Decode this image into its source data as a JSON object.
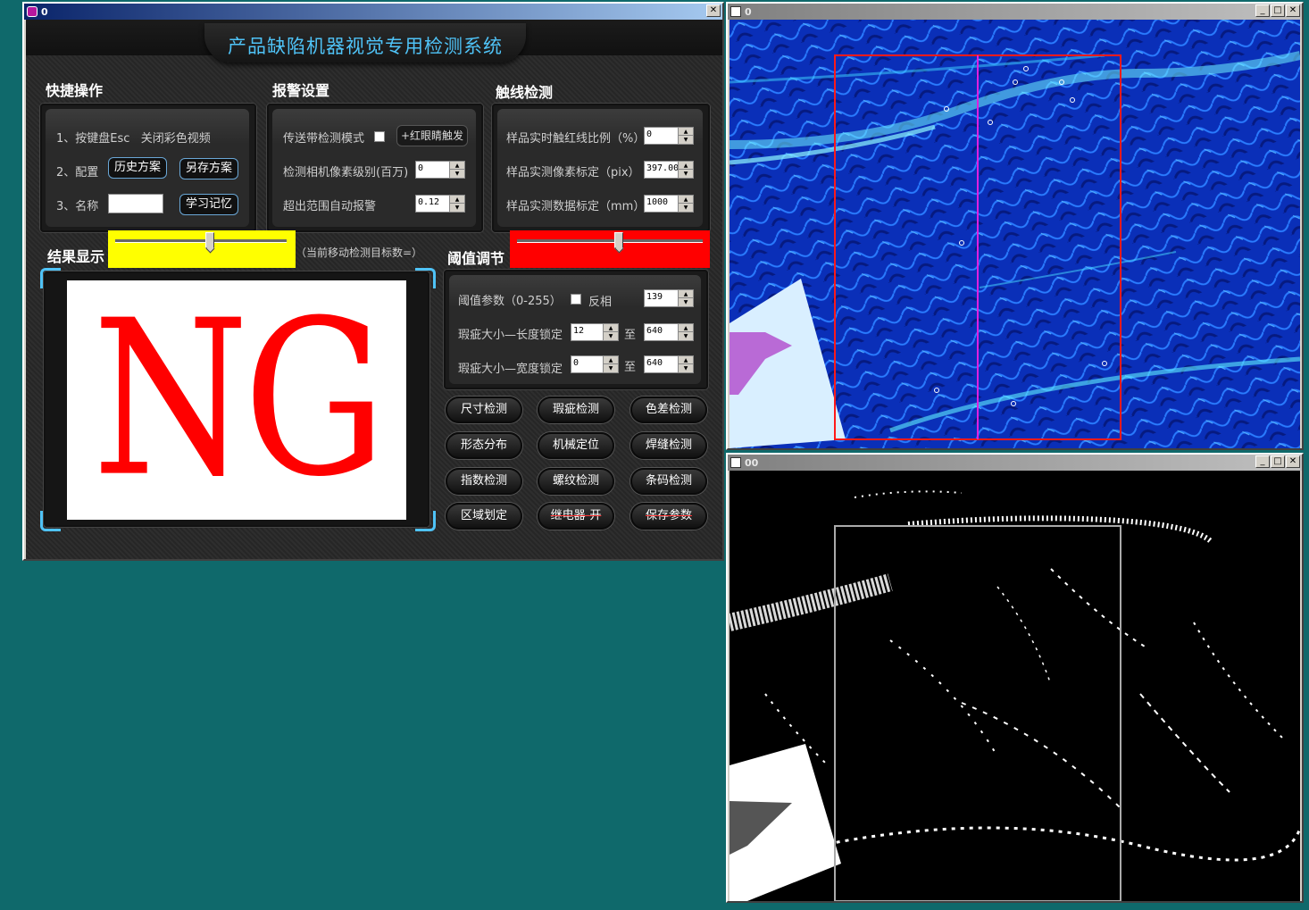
{
  "main_window": {
    "title": "0",
    "app_title": "产品缺陷机器视觉专用检测系统"
  },
  "quick_ops": {
    "title": "快捷操作",
    "line1": "1、按键盘Esc   关闭彩色视频",
    "line2_label": "2、配置",
    "history_btn": "历史方案",
    "saveas_btn": "另存方案",
    "line3_label": "3、名称",
    "name_value": "",
    "learn_btn": "学习记忆"
  },
  "alarm": {
    "title": "报警设置",
    "conveyor_label": "传送带检测模式",
    "red_eye_btn": "+红眼睛触发",
    "pixel_label": "检测相机像素级别(百万)",
    "pixel_value": "0",
    "out_range_label": "超出范围自动报警",
    "out_range_value": "0.12"
  },
  "touch_line": {
    "title": "触线检测",
    "ratio_label": "样品实时触红线比例（%）",
    "ratio_value": "0",
    "pix_label": "样品实测像素标定（pix）",
    "pix_value": "397.00",
    "mm_label": "样品实测数据标定（mm）",
    "mm_value": "1000"
  },
  "result": {
    "title": "结果显示",
    "move_count_label": "（当前移动检测目标数=）",
    "ng_text": "NG",
    "slider_position": 0.55
  },
  "threshold": {
    "title": "阈值调节",
    "slider_position": 0.55,
    "param_label": "阈值参数（0-255）",
    "invert_label": "反相",
    "param_value": "139",
    "len_label": "瑕疵大小—长度锁定",
    "len_min": "12",
    "to1": "至",
    "len_max": "640",
    "wid_label": "瑕疵大小—宽度锁定",
    "wid_min": "0",
    "to2": "至",
    "wid_max": "640"
  },
  "buttons": [
    [
      "尺寸检测",
      "瑕疵检测",
      "色差检测"
    ],
    [
      "形态分布",
      "机械定位",
      "焊缝检测"
    ],
    [
      "指数检测",
      "螺纹检测",
      "条码检测"
    ],
    [
      "区域划定",
      "继电器-开",
      "保存参数"
    ]
  ],
  "colors": {
    "yellow": "#ffff00",
    "red": "#ff0000",
    "accent": "#4fc3f7",
    "desktop": "#0f696b"
  },
  "image_windows": [
    {
      "title": "0"
    },
    {
      "title": "00"
    }
  ]
}
